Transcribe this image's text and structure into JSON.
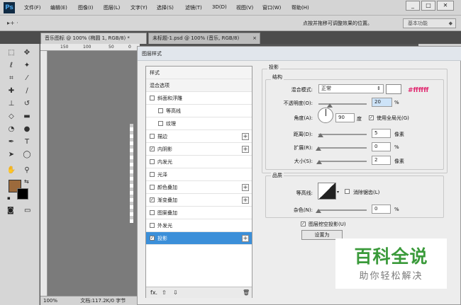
{
  "app": {
    "logo": "Ps"
  },
  "menu": [
    "文件(F)",
    "编辑(E)",
    "图像(I)",
    "图层(L)",
    "文字(Y)",
    "选择(S)",
    "滤镜(T)",
    "3D(D)",
    "视图(V)",
    "窗口(W)",
    "帮助(H)"
  ],
  "window_controls": {
    "minimize": "_",
    "maximize": "□",
    "close": "✕"
  },
  "options": {
    "tool_glyph": "▸+ ·",
    "hint": "点按并拖移可调整效果的位置。",
    "workspace": "基本功能"
  },
  "tabs": [
    "音乐图标 @ 100% (椭圆 1, RGB/8) *",
    "未标题-1.psd @ 100% (音乐, RGB/8)"
  ],
  "tab_close": "×",
  "ruler": [
    "150",
    "100",
    "50",
    "0"
  ],
  "status": {
    "zoom": "100%",
    "doc": "文档:117.2K/0 字节"
  },
  "dialog": {
    "title": "图层样式",
    "styles": [
      {
        "label": "样式",
        "check": false,
        "plus": false,
        "header": true
      },
      {
        "label": "混合选项",
        "check": false,
        "plus": false,
        "header": true
      },
      {
        "label": "斜面和浮雕",
        "check": true,
        "checked": false,
        "plus": false
      },
      {
        "label": "等高线",
        "check": true,
        "checked": false,
        "plus": false,
        "indent": true
      },
      {
        "label": "纹理",
        "check": true,
        "checked": false,
        "plus": false,
        "indent": true
      },
      {
        "label": "描边",
        "check": true,
        "checked": false,
        "plus": true
      },
      {
        "label": "内阴影",
        "check": true,
        "checked": true,
        "plus": true
      },
      {
        "label": "内发光",
        "check": true,
        "checked": false,
        "plus": false
      },
      {
        "label": "光泽",
        "check": true,
        "checked": false,
        "plus": false
      },
      {
        "label": "颜色叠加",
        "check": true,
        "checked": false,
        "plus": true
      },
      {
        "label": "渐变叠加",
        "check": true,
        "checked": true,
        "plus": true
      },
      {
        "label": "图案叠加",
        "check": true,
        "checked": false,
        "plus": false
      },
      {
        "label": "外发光",
        "check": true,
        "checked": false,
        "plus": false
      },
      {
        "label": "投影",
        "check": true,
        "checked": true,
        "plus": true,
        "selected": true
      }
    ],
    "list_footer": {
      "fx": "fx.",
      "up": "⇧",
      "down": "⇩",
      "trash": "🗑"
    },
    "section": "投影",
    "structure": "结构",
    "blend_mode_label": "混合模式:",
    "blend_mode": "正常",
    "annotation": "#ffffff",
    "opacity_label": "不透明度(O):",
    "opacity": "20",
    "angle_label": "角度(A):",
    "angle": "90",
    "degree": "度",
    "global_light": "使用全局光(G)",
    "distance_label": "距离(D):",
    "distance": "5",
    "spread_label": "扩展(R):",
    "spread": "0",
    "size_label": "大小(S):",
    "size": "2",
    "pct": "%",
    "px": "像素",
    "quality": "品质",
    "contour_label": "等高线:",
    "antialias": "消除锯齿(L)",
    "noise_label": "杂色(N):",
    "noise": "0",
    "knockout": "图层挖空投影(U)",
    "set_default": "设置为"
  },
  "watermark": {
    "title": "百科全说",
    "subtitle": "助你轻松解决"
  },
  "colors": {
    "fg": "#9c6a3c",
    "bg": "#000000",
    "selection": "#3b8fd9",
    "annotation": "#e0266e",
    "watermark": "#3a9a3a"
  }
}
